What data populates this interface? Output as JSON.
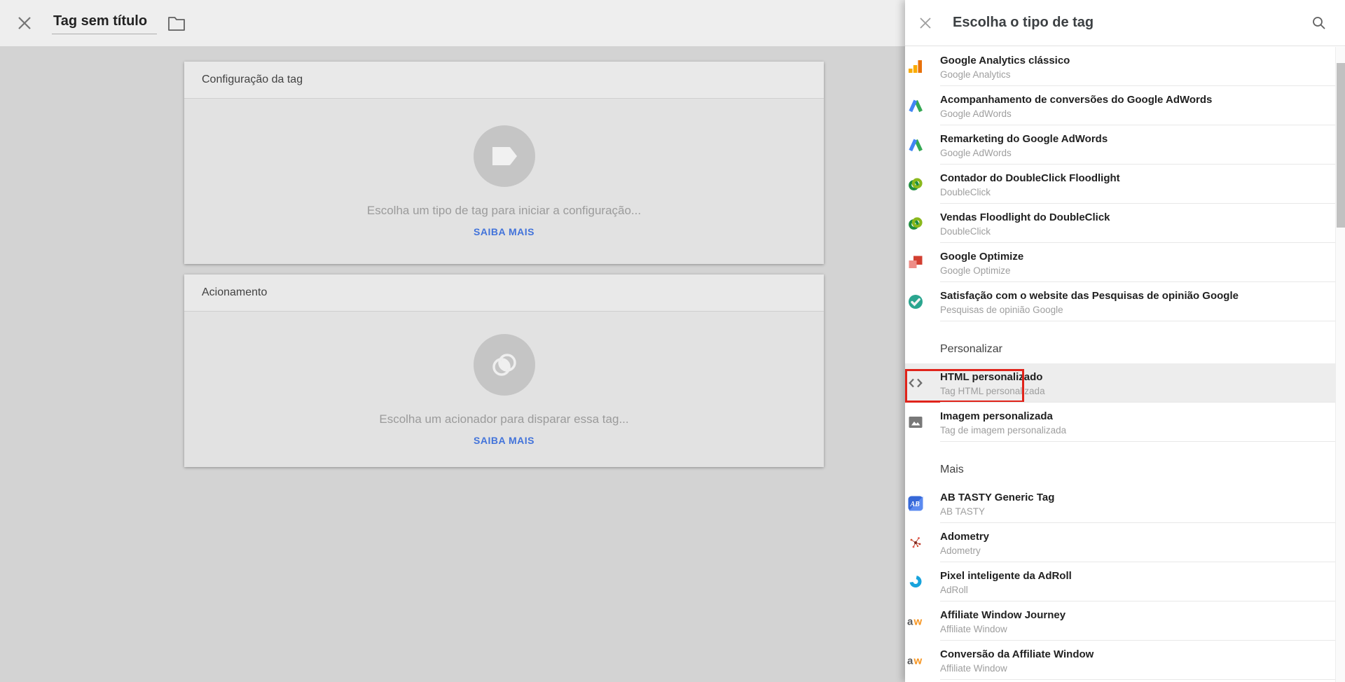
{
  "colors": {
    "accent_blue": "#4273da",
    "highlight_red": "#e0241b",
    "canvas_gray": "#d3d3d3",
    "panel_white": "#ffffff"
  },
  "editor": {
    "title": "Tag sem título",
    "cards": {
      "tag_config": {
        "header": "Configuração da tag",
        "hint": "Escolha um tipo de tag para iniciar a configuração...",
        "learn_more": "SAIBA MAIS"
      },
      "trigger": {
        "header": "Acionamento",
        "hint": "Escolha um acionador para disparar essa tag...",
        "learn_more": "SAIBA MAIS"
      }
    }
  },
  "panel": {
    "title": "Escolha o tipo de tag",
    "sections": [
      {
        "header": null,
        "items": [
          {
            "icon": "google-analytics-classic",
            "title": "Google Analytics clássico",
            "subtitle": "Google Analytics"
          },
          {
            "icon": "adwords-conversion",
            "title": "Acompanhamento de conversões do Google AdWords",
            "subtitle": "Google AdWords"
          },
          {
            "icon": "adwords-remarketing",
            "title": "Remarketing do Google AdWords",
            "subtitle": "Google AdWords"
          },
          {
            "icon": "doubleclick-counter",
            "title": "Contador do DoubleClick Floodlight",
            "subtitle": "DoubleClick"
          },
          {
            "icon": "doubleclick-sales",
            "title": "Vendas Floodlight do DoubleClick",
            "subtitle": "DoubleClick"
          },
          {
            "icon": "google-optimize",
            "title": "Google Optimize",
            "subtitle": "Google Optimize"
          },
          {
            "icon": "google-surveys",
            "title": "Satisfação com o website das Pesquisas de opinião Google",
            "subtitle": "Pesquisas de opinião Google"
          }
        ]
      },
      {
        "header": "Personalizar",
        "items": [
          {
            "icon": "custom-html",
            "title": "HTML personalizado",
            "subtitle": "Tag HTML personalizada",
            "highlighted": true
          },
          {
            "icon": "custom-image",
            "title": "Imagem personalizada",
            "subtitle": "Tag de imagem personalizada"
          }
        ]
      },
      {
        "header": "Mais",
        "items": [
          {
            "icon": "ab-tasty",
            "icon_text": "AB",
            "title": "AB TASTY Generic Tag",
            "subtitle": "AB TASTY"
          },
          {
            "icon": "adometry",
            "title": "Adometry",
            "subtitle": "Adometry"
          },
          {
            "icon": "adroll",
            "title": "Pixel inteligente da AdRoll",
            "subtitle": "AdRoll"
          },
          {
            "icon": "affiliate-window",
            "icon_text": "aw",
            "title": "Affiliate Window Journey",
            "subtitle": "Affiliate Window"
          },
          {
            "icon": "affiliate-window",
            "icon_text": "aw",
            "title": "Conversão da Affiliate Window",
            "subtitle": "Affiliate Window"
          }
        ]
      }
    ]
  }
}
